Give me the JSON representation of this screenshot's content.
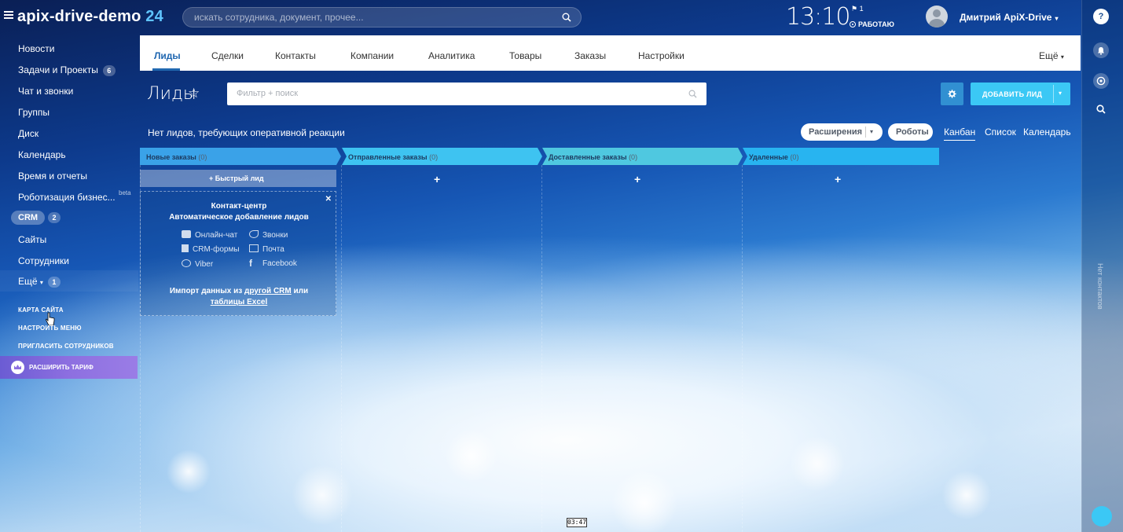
{
  "header": {
    "logo_text": "apix-drive-demo",
    "logo_num": "24",
    "search_placeholder": "искать сотрудника, документ, прочее...",
    "clock": "13:10",
    "flag_count": "1",
    "work_status": "РАБОТАЮ",
    "user_name": "Дмитрий ApiX-Drive"
  },
  "sidebar": {
    "items": [
      {
        "label": "Новости"
      },
      {
        "label": "Задачи и Проекты",
        "badge": "6"
      },
      {
        "label": "Чат и звонки"
      },
      {
        "label": "Группы"
      },
      {
        "label": "Диск"
      },
      {
        "label": "Календарь"
      },
      {
        "label": "Время и отчеты"
      },
      {
        "label": "Роботизация бизнес...",
        "tag": "beta"
      },
      {
        "label": "CRM",
        "badge": "2"
      },
      {
        "label": "Сайты"
      },
      {
        "label": "Сотрудники"
      },
      {
        "label": "Ещё",
        "badge": "1"
      }
    ],
    "links": [
      "КАРТА САЙТА",
      "НАСТРОИТЬ МЕНЮ",
      "ПРИГЛАСИТЬ СОТРУДНИКОВ"
    ],
    "upgrade_label": "РАСШИРИТЬ ТАРИФ"
  },
  "tabs": [
    "Лиды",
    "Сделки",
    "Контакты",
    "Компании",
    "Аналитика",
    "Товары",
    "Заказы",
    "Настройки"
  ],
  "tabs_more": "Ещё",
  "page": {
    "title": "Лиды",
    "filter_placeholder": "Фильтр + поиск",
    "add_button": "ДОБАВИТЬ ЛИД",
    "notice": "Нет лидов, требующих оперативной реакции",
    "extensions_button": "Расширения",
    "robots_button": "Роботы",
    "views": [
      "Канбан",
      "Список",
      "Календарь"
    ]
  },
  "kanban": {
    "columns": [
      {
        "name": "Новые заказы",
        "count": "(0)",
        "color": "#3aa2e8"
      },
      {
        "name": "Отправленные заказы",
        "count": "(0)",
        "color": "#3ec3f1"
      },
      {
        "name": "Доставленные заказы",
        "count": "(0)",
        "color": "#4fc8e0"
      },
      {
        "name": "Удаленные",
        "count": "(0)",
        "color": "#28b4f0"
      }
    ],
    "quick_lead": "Быстрый лид",
    "contact_center": {
      "title": "Контакт-центр",
      "subtitle": "Автоматическое добавление лидов",
      "channels": [
        "Онлайн-чат",
        "Звонки",
        "CRM-формы",
        "Почта",
        "Viber",
        "Facebook"
      ],
      "import_prefix": "Импорт данных из",
      "import_link1": "другой CRM",
      "import_mid": "или",
      "import_link2": "таблицы Excel"
    }
  },
  "rightbar": {
    "vertical_label": "Нет контактов"
  },
  "video_timestamp": "03:47",
  "colors": {
    "accent": "#2067b0",
    "add_button": "#3bc8f5",
    "upgrade": "#8d6fe0"
  }
}
